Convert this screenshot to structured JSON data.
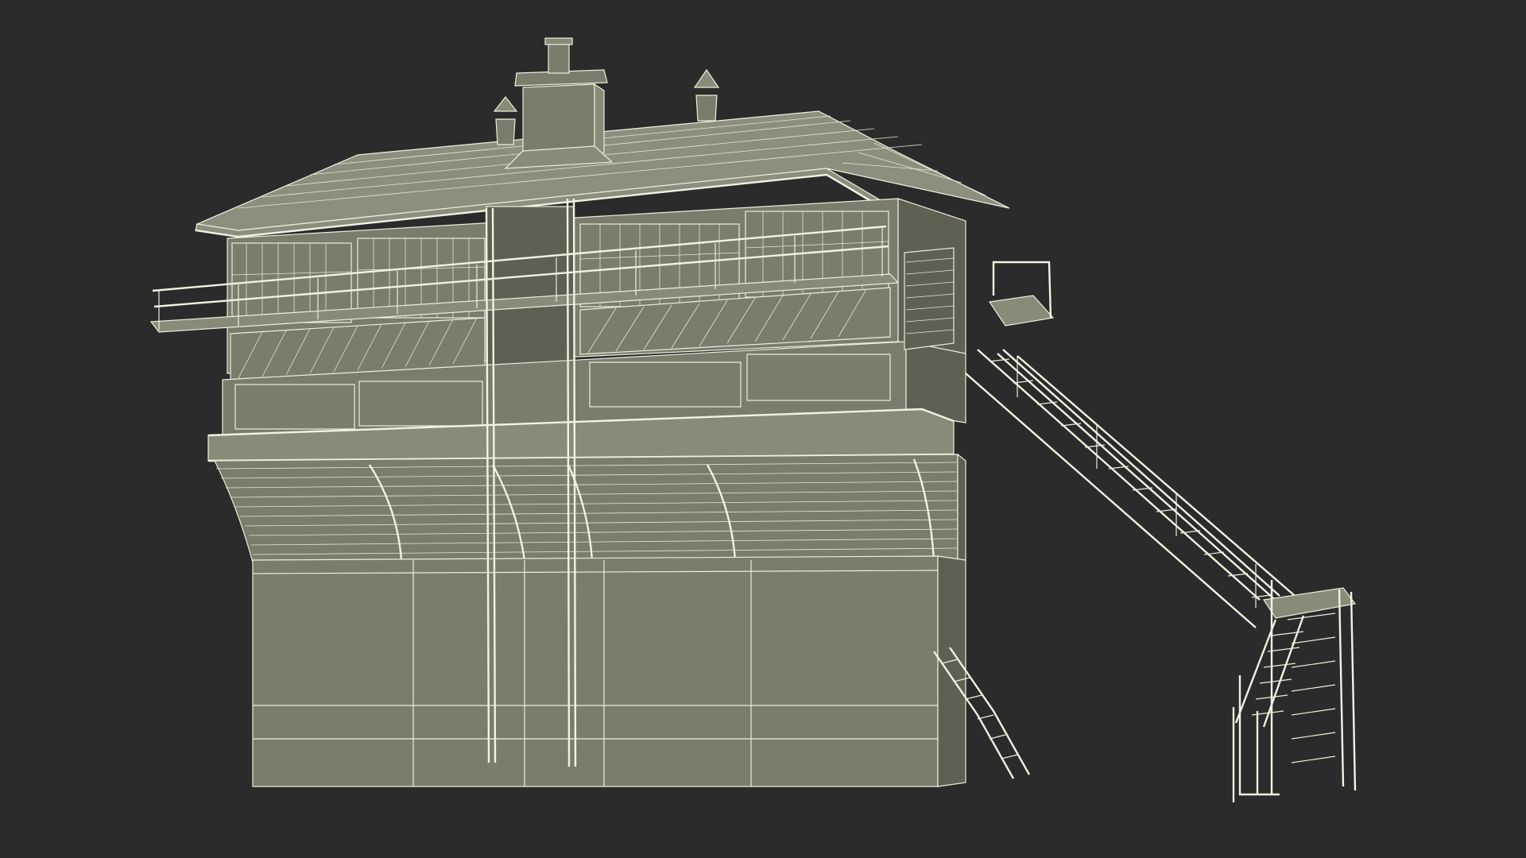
{
  "scene": {
    "background_color": "#2b2b2b",
    "model_fill_color": "#7c7c6c",
    "wireframe_color": "#eeeedd"
  }
}
